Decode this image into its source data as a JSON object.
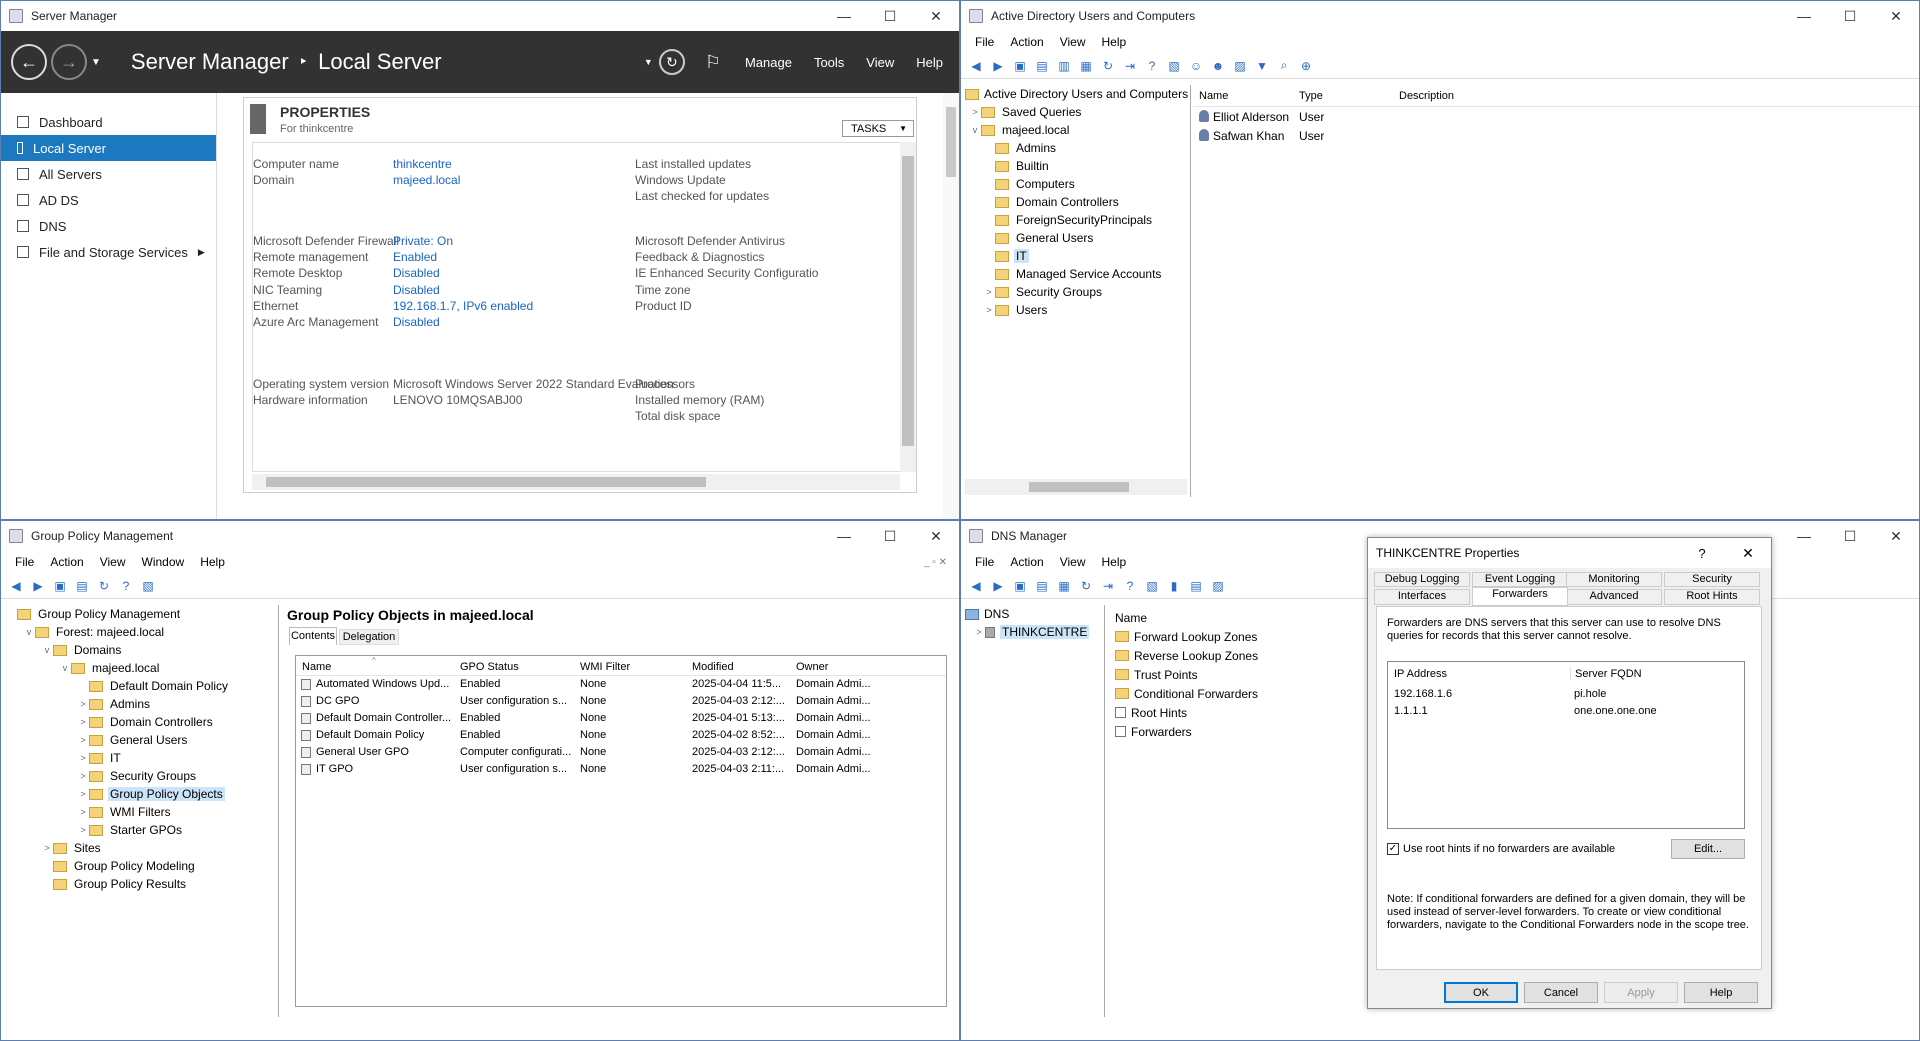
{
  "server_manager": {
    "window_title": "Server Manager",
    "breadcrumb_app": "Server Manager",
    "breadcrumb_sep": "‣",
    "breadcrumb_page": "Local Server",
    "menu": [
      "Manage",
      "Tools",
      "View",
      "Help"
    ],
    "nav": [
      "Dashboard",
      "Local Server",
      "All Servers",
      "AD DS",
      "DNS",
      "File and Storage Services"
    ],
    "properties_title": "PROPERTIES",
    "properties_subtitle": "For thinkcentre",
    "tasks_label": "TASKS",
    "left_props": [
      {
        "label": "Computer name",
        "value": "thinkcentre"
      },
      {
        "label": "Domain",
        "value": "majeed.local"
      },
      {
        "label": "Microsoft Defender Firewall",
        "value": "Private: On"
      },
      {
        "label": "Remote management",
        "value": "Enabled"
      },
      {
        "label": "Remote Desktop",
        "value": "Disabled"
      },
      {
        "label": "NIC Teaming",
        "value": "Disabled"
      },
      {
        "label": "Ethernet",
        "value": "192.168.1.7, IPv6 enabled"
      },
      {
        "label": "Azure Arc Management",
        "value": "Disabled"
      },
      {
        "label": "Operating system version",
        "value": "Microsoft Windows Server 2022 Standard Evaluation"
      },
      {
        "label": "Hardware information",
        "value": "LENOVO 10MQSABJ00"
      }
    ],
    "right_props": [
      "Last installed updates",
      "Windows Update",
      "Last checked for updates",
      "Microsoft Defender Antivirus",
      "Feedback & Diagnostics",
      "IE Enhanced Security Configuratio",
      "Time zone",
      "Product ID",
      "Processors",
      "Installed memory (RAM)",
      "Total disk space"
    ]
  },
  "aduc": {
    "window_title": "Active Directory Users and Computers",
    "menu": [
      "File",
      "Action",
      "View",
      "Help"
    ],
    "tree_root": "Active Directory Users and Computers",
    "tree": [
      "Saved Queries",
      "majeed.local",
      "Admins",
      "Builtin",
      "Computers",
      "Domain Controllers",
      "ForeignSecurityPrincipals",
      "General Users",
      "IT",
      "Managed Service Accounts",
      "Security Groups",
      "Users"
    ],
    "columns": [
      "Name",
      "Type",
      "Description"
    ],
    "rows": [
      {
        "name": "Elliot Alderson",
        "type": "User"
      },
      {
        "name": "Safwan Khan",
        "type": "User"
      }
    ]
  },
  "gpm": {
    "window_title": "Group Policy Management",
    "menu": [
      "File",
      "Action",
      "View",
      "Window",
      "Help"
    ],
    "tree": [
      "Group Policy Management",
      "Forest: majeed.local",
      "Domains",
      "majeed.local",
      "Default Domain Policy",
      "Admins",
      "Domain Controllers",
      "General Users",
      "IT",
      "Security Groups",
      "Group Policy Objects",
      "WMI Filters",
      "Starter GPOs",
      "Sites",
      "Group Policy Modeling",
      "Group Policy Results"
    ],
    "pane_title": "Group Policy Objects in majeed.local",
    "tabs": [
      "Contents",
      "Delegation"
    ],
    "columns": [
      "Name",
      "GPO Status",
      "WMI Filter",
      "Modified",
      "Owner"
    ],
    "rows": [
      [
        "Automated Windows Upd...",
        "Enabled",
        "None",
        "2025-04-04 11:5...",
        "Domain Admi..."
      ],
      [
        "DC GPO",
        "User configuration s...",
        "None",
        "2025-04-03 2:12:...",
        "Domain Admi..."
      ],
      [
        "Default Domain Controller...",
        "Enabled",
        "None",
        "2025-04-01 5:13:...",
        "Domain Admi..."
      ],
      [
        "Default Domain Policy",
        "Enabled",
        "None",
        "2025-04-02 8:52:...",
        "Domain Admi..."
      ],
      [
        "General User GPO",
        "Computer configurati...",
        "None",
        "2025-04-03 2:12:...",
        "Domain Admi..."
      ],
      [
        "IT GPO",
        "User configuration s...",
        "None",
        "2025-04-03 2:11:...",
        "Domain Admi..."
      ]
    ]
  },
  "dns": {
    "window_title": "DNS Manager",
    "menu": [
      "File",
      "Action",
      "View",
      "Help"
    ],
    "tree": [
      "DNS",
      "THINKCENTRE"
    ],
    "column": "Name",
    "items": [
      "Forward Lookup Zones",
      "Reverse Lookup Zones",
      "Trust Points",
      "Conditional Forwarders",
      "Root Hints",
      "Forwarders"
    ]
  },
  "dialog": {
    "title": "THINKCENTRE Properties",
    "help": "?",
    "tabs_row1": [
      "Debug Logging",
      "Event Logging",
      "Monitoring",
      "Security"
    ],
    "tabs_row2": [
      "Interfaces",
      "Forwarders",
      "Advanced",
      "Root Hints"
    ],
    "description": "Forwarders are DNS servers that this server can use to resolve DNS queries for records that this server cannot resolve.",
    "columns": [
      "IP Address",
      "Server FQDN"
    ],
    "forwarders": [
      {
        "ip": "192.168.1.6",
        "fqdn": "pi.hole"
      },
      {
        "ip": "1.1.1.1",
        "fqdn": "one.one.one.one"
      }
    ],
    "checkbox_label": "Use root hints if no forwarders are available",
    "edit": "Edit...",
    "note": "Note: If conditional forwarders are defined for a given domain, they will be used instead of server-level forwarders.  To create or view conditional forwarders, navigate to the Conditional Forwarders node in the scope tree.",
    "buttons": [
      "OK",
      "Cancel",
      "Apply",
      "Help"
    ]
  }
}
